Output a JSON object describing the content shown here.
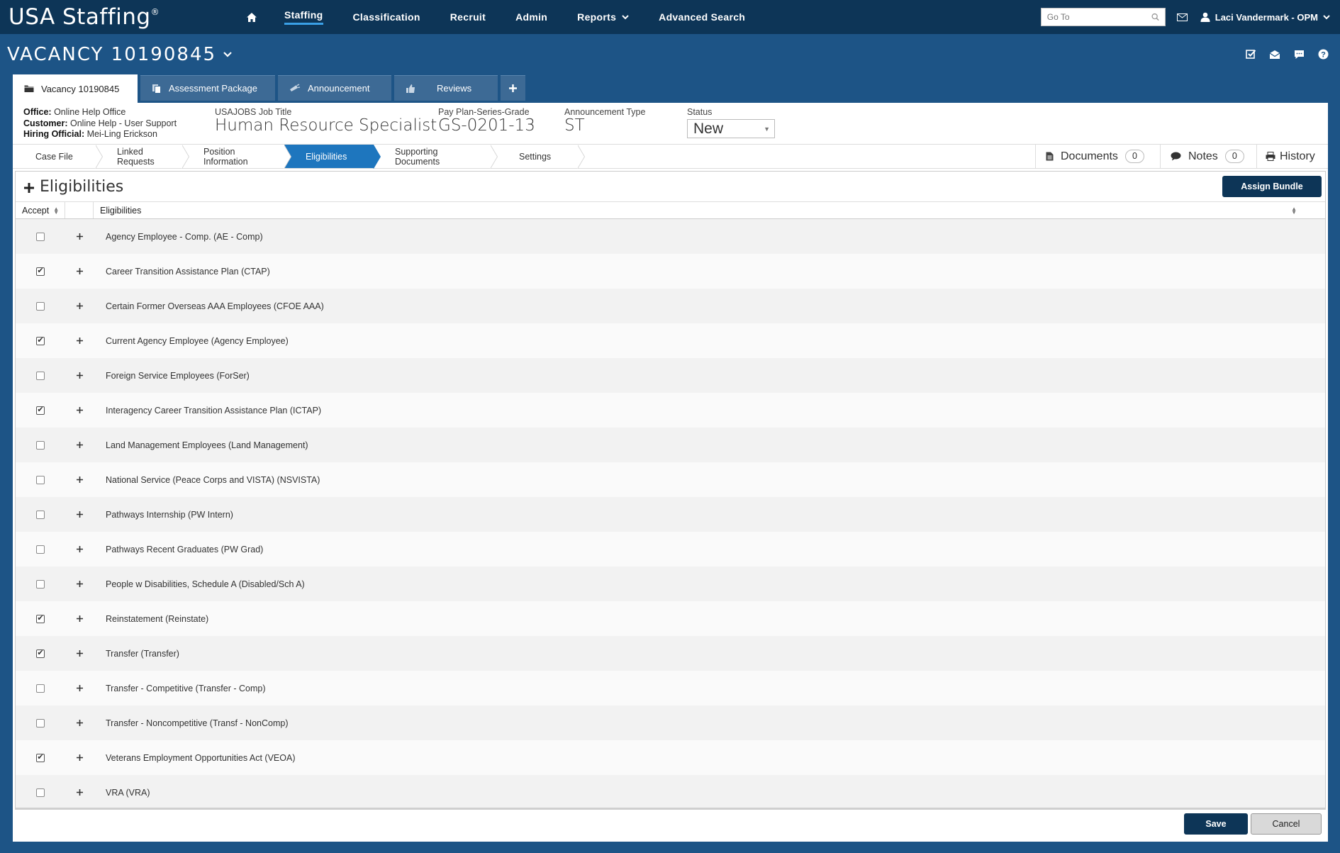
{
  "app": {
    "brand": "USA Staffing",
    "brand_mark": "®"
  },
  "nav": {
    "items": [
      {
        "label": "Staffing",
        "active": true
      },
      {
        "label": "Classification"
      },
      {
        "label": "Recruit"
      },
      {
        "label": "Admin"
      },
      {
        "label": "Reports",
        "dropdown": true
      },
      {
        "label": "Advanced Search"
      }
    ],
    "goto_placeholder": "Go To",
    "user": "Laci Vandermark - OPM"
  },
  "vacancy": {
    "title": "VACANCY 10190845"
  },
  "tabs": [
    {
      "label": "Vacancy 10190845",
      "icon": "folder-icon",
      "active": true
    },
    {
      "label": "Assessment Package",
      "icon": "copy-icon"
    },
    {
      "label": "Announcement",
      "icon": "megaphone-icon"
    },
    {
      "label": "Reviews",
      "icon": "thumbs-up-icon"
    }
  ],
  "info": {
    "office_label": "Office:",
    "office": "Online Help Office",
    "customer_label": "Customer:",
    "customer": "Online Help - User Support",
    "hiring_label": "Hiring Official:",
    "hiring": "Mei-Ling Erickson",
    "job_title_label": "USAJOBS Job Title",
    "job_title": "Human Resource Specialist",
    "pay_label": "Pay Plan-Series-Grade",
    "pay": "GS-0201-13",
    "ann_type_label": "Announcement Type",
    "ann_type": "ST",
    "status_label": "Status",
    "status": "New"
  },
  "steps": [
    {
      "label": "Case File"
    },
    {
      "label": "Linked Requests"
    },
    {
      "label": "Position Information"
    },
    {
      "label": "Eligibilities",
      "active": true
    },
    {
      "label": "Supporting Documents"
    },
    {
      "label": "Settings"
    }
  ],
  "side": {
    "documents_label": "Documents",
    "documents_count": "0",
    "notes_label": "Notes",
    "notes_count": "0",
    "history_label": "History"
  },
  "eligibilities": {
    "heading": "Eligibilities",
    "assign_label": "Assign Bundle",
    "col_accept": "Accept",
    "col_name": "Eligibilities",
    "rows": [
      {
        "name": "Agency Employee - Comp. (AE - Comp)",
        "checked": false
      },
      {
        "name": "Career Transition Assistance Plan (CTAP)",
        "checked": true
      },
      {
        "name": "Certain Former Overseas AAA Employees (CFOE AAA)",
        "checked": false
      },
      {
        "name": "Current Agency Employee (Agency Employee)",
        "checked": true
      },
      {
        "name": "Foreign Service Employees (ForSer)",
        "checked": false
      },
      {
        "name": "Interagency Career Transition Assistance Plan (ICTAP)",
        "checked": true
      },
      {
        "name": "Land Management Employees (Land Management)",
        "checked": false
      },
      {
        "name": "National Service (Peace Corps and VISTA) (NSVISTA)",
        "checked": false
      },
      {
        "name": "Pathways Internship (PW Intern)",
        "checked": false
      },
      {
        "name": "Pathways Recent Graduates (PW Grad)",
        "checked": false
      },
      {
        "name": "People w Disabilities, Schedule A (Disabled/Sch A)",
        "checked": false
      },
      {
        "name": "Reinstatement (Reinstate)",
        "checked": true
      },
      {
        "name": "Transfer (Transfer)",
        "checked": true
      },
      {
        "name": "Transfer - Competitive (Transfer - Comp)",
        "checked": false
      },
      {
        "name": "Transfer - Noncompetitive (Transf - NonComp)",
        "checked": false
      },
      {
        "name": "Veterans Employment Opportunities Act (VEOA)",
        "checked": true
      },
      {
        "name": "VRA (VRA)",
        "checked": false
      }
    ]
  },
  "footer": {
    "save_label": "Save",
    "cancel_label": "Cancel"
  }
}
